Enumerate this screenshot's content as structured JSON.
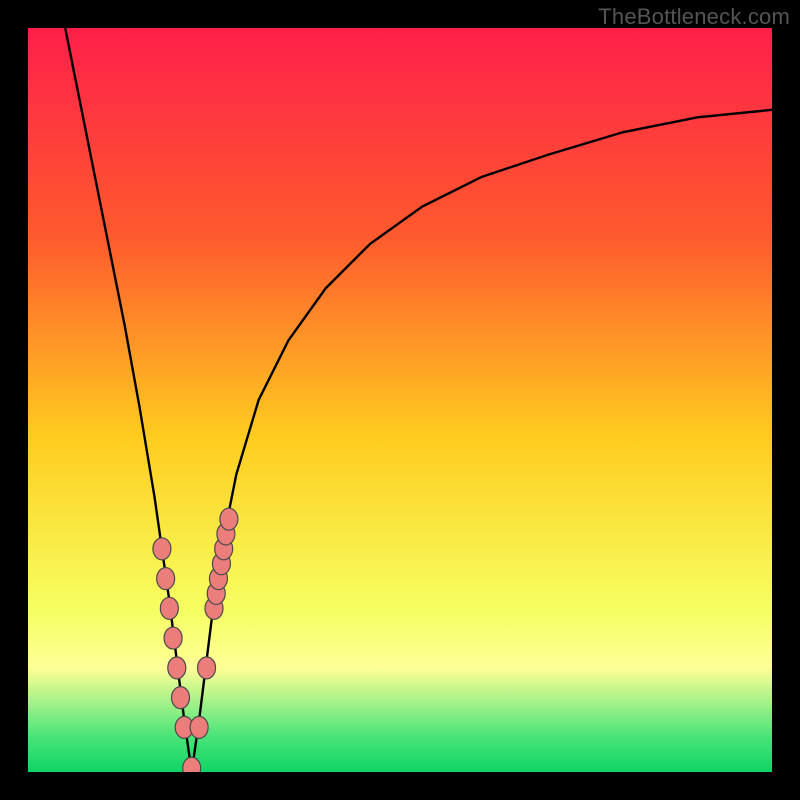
{
  "watermark": "TheBottleneck.com",
  "colors": {
    "frame": "#000000",
    "curve": "#000000",
    "markers_fill": "#eb7d7a",
    "markers_stroke": "#4a4a4a",
    "grad_top": "#ff1f4a",
    "grad_upper": "#ff5a2e",
    "grad_mid": "#ffcc1f",
    "grad_lower": "#f6ff60",
    "grad_band": "#ffff97",
    "grad_base1": "#4de57a",
    "grad_base2": "#0fd465"
  },
  "chart_data": {
    "type": "line",
    "title": "",
    "xlabel": "",
    "ylabel": "",
    "xlim": [
      0,
      100
    ],
    "ylim": [
      0,
      100
    ],
    "grid": false,
    "legend": false,
    "note": "No axis ticks or numeric labels are drawn in the image; curve values are estimated from pixel positions on a 0–100 normalized canvas. The plot shows a V-shaped bottleneck curve with its minimum near x≈22.",
    "series": [
      {
        "name": "bottleneck-curve",
        "x": [
          5,
          7,
          9,
          11,
          13,
          15,
          17,
          18,
          19,
          20,
          21,
          22,
          23,
          24,
          25,
          26,
          28,
          31,
          35,
          40,
          46,
          53,
          61,
          70,
          80,
          90,
          100
        ],
        "y": [
          100,
          90,
          80,
          70,
          60,
          49,
          37,
          30,
          23,
          15,
          7,
          0,
          7,
          15,
          23,
          30,
          40,
          50,
          58,
          65,
          71,
          76,
          80,
          83,
          86,
          88,
          89
        ]
      }
    ],
    "markers": {
      "name": "highlighted-points",
      "x": [
        18.0,
        18.5,
        19.0,
        19.5,
        20.0,
        20.5,
        21.0,
        22.0,
        23.0,
        24.0,
        25.0,
        25.3,
        25.6,
        26.0,
        26.3,
        26.6,
        27.0
      ],
      "y": [
        30,
        26,
        22,
        18,
        14,
        10,
        6,
        0.5,
        6,
        14,
        22,
        24,
        26,
        28,
        30,
        32,
        34
      ]
    }
  }
}
